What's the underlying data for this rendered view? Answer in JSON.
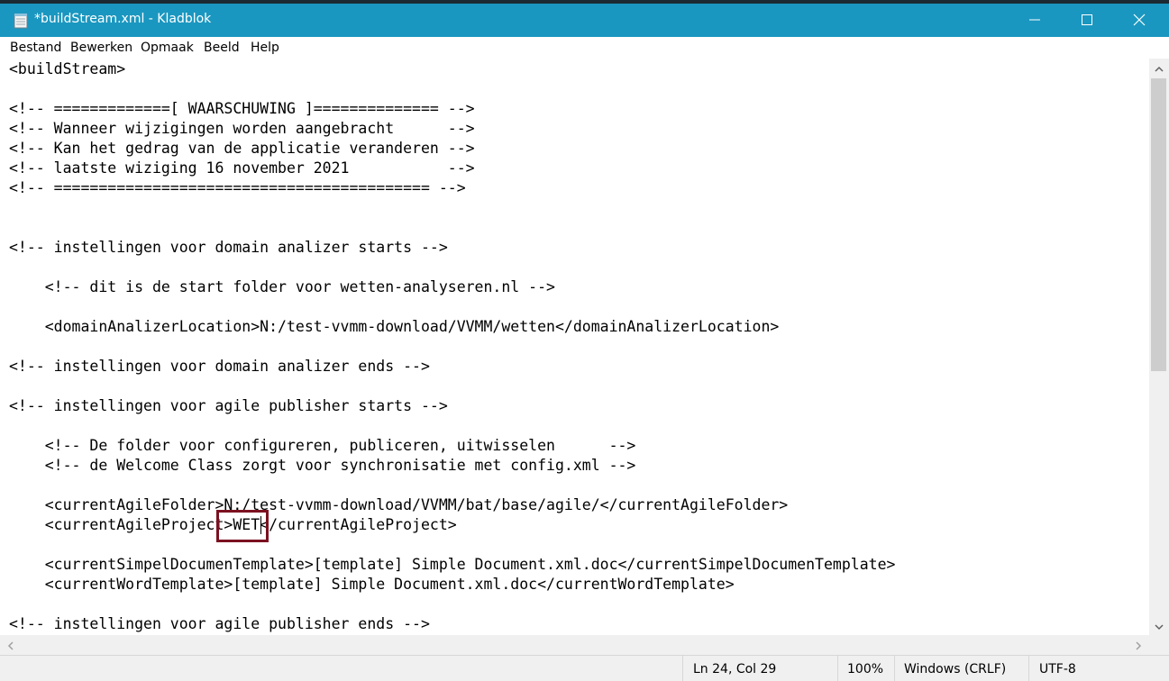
{
  "window": {
    "title": "*buildStream.xml - Kladblok",
    "titlebar_color": "#1a97c0"
  },
  "menu": [
    "Bestand",
    "Bewerken",
    "Opmaak",
    "Beeld",
    "Help"
  ],
  "editor": {
    "lines": [
      "<buildStream>",
      "",
      "<!-- =============[ WAARSCHUWING ]============== -->",
      "<!-- Wanneer wijzigingen worden aangebracht      -->",
      "<!-- Kan het gedrag van de applicatie veranderen -->",
      "<!-- laatste wiziging 16 november 2021           -->",
      "<!-- ========================================== -->",
      "",
      "",
      "<!-- instellingen voor domain analizer starts -->",
      "",
      "    <!-- dit is de start folder voor wetten-analyseren.nl -->",
      "",
      "    <domainAnalizerLocation>N:/test-vvmm-download/VVMM/wetten</domainAnalizerLocation>",
      "",
      "<!-- instellingen voor domain analizer ends -->",
      "",
      "<!-- instellingen voor agile publisher starts -->",
      "",
      "    <!-- De folder voor configureren, publiceren, uitwisselen      -->",
      "    <!-- de Welcome Class zorgt voor synchronisatie met config.xml -->",
      "",
      "    <currentAgileFolder>N:/test-vvmm-download/VVMM/bat/base/agile/</currentAgileFolder>",
      "    <currentAgileProject>WET</currentAgileProject>",
      "",
      "    <currentSimpelDocumenTemplate>[template] Simple Document.xml.doc</currentSimpelDocumenTemplate>",
      "    <currentWordTemplate>[template] Simple Document.xml.doc</currentWordTemplate>",
      "",
      "<!-- instellingen voor agile publisher ends -->"
    ]
  },
  "status": {
    "position": "Ln 24, Col 29",
    "zoom": "100%",
    "line_ending": "Windows (CRLF)",
    "encoding": "UTF-8"
  },
  "highlight_color": "#7b1120"
}
